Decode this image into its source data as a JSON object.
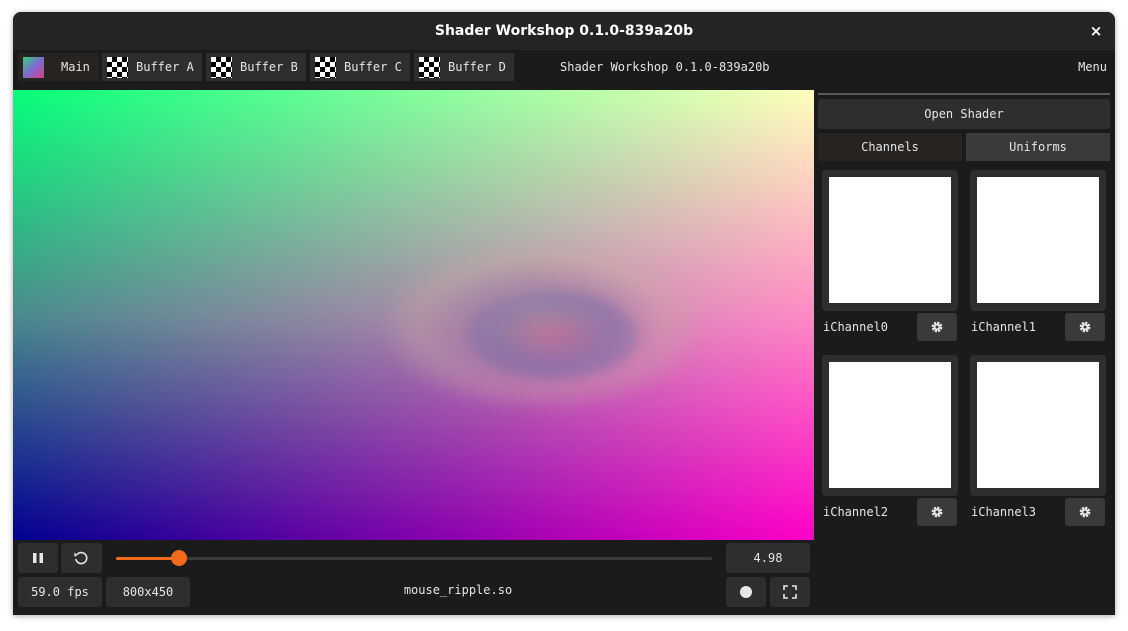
{
  "window": {
    "title": "Shader Workshop 0.1.0-839a20b",
    "close_glyph": "×"
  },
  "tabs": [
    {
      "label": "Main",
      "icon": "gradient-icon",
      "active": true
    },
    {
      "label": "Buffer A",
      "icon": "checker-icon",
      "active": false
    },
    {
      "label": "Buffer B",
      "icon": "checker-icon",
      "active": false
    },
    {
      "label": "Buffer C",
      "icon": "checker-icon",
      "active": false
    },
    {
      "label": "Buffer D",
      "icon": "checker-icon",
      "active": false
    }
  ],
  "header": {
    "center_title": "Shader Workshop 0.1.0-839a20b",
    "menu": "Menu"
  },
  "controls": {
    "pause_icon": "pause-icon",
    "reset_icon": "reset-icon",
    "time_value": "4.98",
    "progress": 0.105,
    "fps": "59.0 fps",
    "resolution": "800x450",
    "filename": "mouse_ripple.so",
    "record_icon": "record-icon",
    "fullscreen_icon": "fullscreen-icon"
  },
  "right_panel": {
    "open_shader": "Open Shader",
    "tabs": [
      {
        "label": "Channels",
        "active": true
      },
      {
        "label": "Uniforms",
        "active": false
      }
    ],
    "channels": [
      "iChannel0",
      "iChannel1",
      "iChannel2",
      "iChannel3"
    ]
  },
  "colors": {
    "accent": "#f26a1b",
    "bg": "#1b1b1b",
    "button": "#2e2e2e"
  }
}
